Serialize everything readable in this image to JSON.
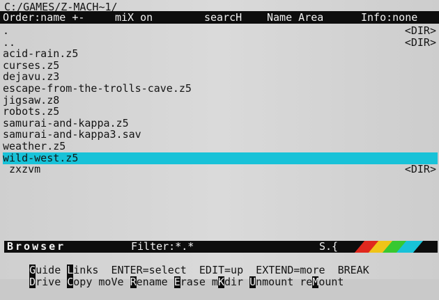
{
  "path": "C:/GAMES/Z-MACH~1/",
  "toolbar": {
    "order": "Order:name +-",
    "mix": "miX on",
    "search": "searcH",
    "name_area": "Name Area",
    "info": "Info:none"
  },
  "files": [
    {
      "name": ".",
      "tag": "<DIR>"
    },
    {
      "name": "..",
      "tag": "<DIR>"
    },
    {
      "name": "acid-rain.z5",
      "tag": ""
    },
    {
      "name": "curses.z5",
      "tag": ""
    },
    {
      "name": "dejavu.z3",
      "tag": ""
    },
    {
      "name": "escape-from-the-trolls-cave.z5",
      "tag": ""
    },
    {
      "name": "jigsaw.z8",
      "tag": ""
    },
    {
      "name": "robots.z5",
      "tag": ""
    },
    {
      "name": "samurai-and-kappa.z5",
      "tag": ""
    },
    {
      "name": "samurai-and-kappa3.sav",
      "tag": ""
    },
    {
      "name": "weather.z5",
      "tag": ""
    },
    {
      "name": "wild-west.z5",
      "tag": ""
    },
    {
      "name": " zxzvm",
      "tag": "<DIR>"
    }
  ],
  "selected_index": 11,
  "status": {
    "title": "Browser",
    "filter": "Filter:*.*",
    "size_indicator": "S.{"
  },
  "rainbow_colors": [
    "#e0281e",
    "#f0c418",
    "#38c830",
    "#18c2d8"
  ],
  "help_line1": {
    "guide_key": "G",
    "guide_rest": "uide ",
    "links_key": "L",
    "links_rest": "inks  ENTER=select  EDIT=up  EXTEND=more  BREAK"
  },
  "help_line2": {
    "drive_key": "D",
    "drive_rest": "rive ",
    "copy_key": "C",
    "copy_rest": "opy moVe ",
    "rename_key": "R",
    "rename_rest": "ename ",
    "erase_key": "E",
    "erase_rest": "rase m",
    "mkdir_key": "K",
    "mkdir_rest": "dir ",
    "unmount_key": "U",
    "unmount_rest": "nmount re",
    "remount_key": "M",
    "remount_rest": "ount"
  }
}
